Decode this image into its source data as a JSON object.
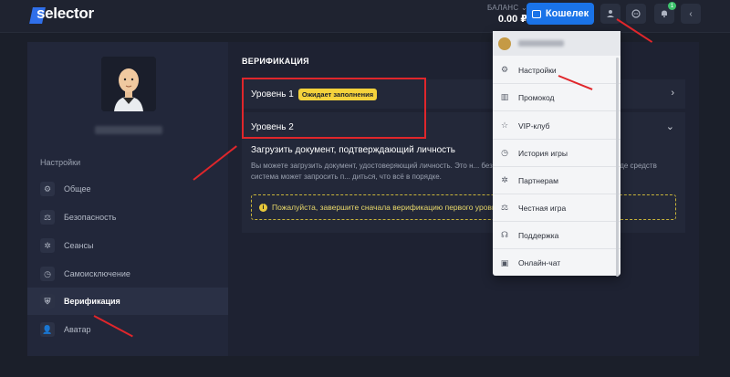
{
  "topbar": {
    "logo": "selector",
    "balance_label": "БАЛАНС ⌄",
    "balance_value": "0.00 ₽",
    "wallet_label": "Кошелек",
    "notif_count": "1"
  },
  "sidebar": {
    "title": "Настройки",
    "items": [
      {
        "label": "Общее",
        "icon": "gear-icon"
      },
      {
        "label": "Безопасность",
        "icon": "scales-icon"
      },
      {
        "label": "Сеансы",
        "icon": "asterisk-icon"
      },
      {
        "label": "Самоисключение",
        "icon": "clock-icon"
      },
      {
        "label": "Верификация",
        "icon": "shield-icon"
      },
      {
        "label": "Аватар",
        "icon": "user-icon"
      }
    ]
  },
  "main": {
    "title": "ВЕРИФИКАЦИЯ",
    "level1_label": "Уровень 1",
    "level1_status": "Ожидает заполнения",
    "level2_label": "Уровень 2",
    "upload_title": "Загрузить документ, подтверждающий личность",
    "upload_text": "Вы можете загрузить документ, удостоверяющий личность. Это н... безопасность аккаунта. Иногда при выводе средств система может запросить п... диться, что всё в порядке.",
    "warning_text": "Пожалуйста, завершите сначала верификацию первого уровня"
  },
  "dropdown": {
    "items": [
      {
        "label": "Настройки",
        "icon": "gear-icon"
      },
      {
        "label": "Промокод",
        "icon": "ticket-icon"
      },
      {
        "label": "VIP-клуб",
        "icon": "star-icon"
      },
      {
        "label": "История игры",
        "icon": "clock-icon"
      },
      {
        "label": "Партнерам",
        "icon": "asterisk-icon"
      },
      {
        "label": "Честная игра",
        "icon": "scales-icon"
      },
      {
        "label": "Поддержка",
        "icon": "headset-icon"
      },
      {
        "label": "Онлайн-чат",
        "icon": "chat-icon"
      }
    ]
  },
  "colors": {
    "accent": "#1a73e8",
    "annotation": "#e0262b",
    "status_pill": "#f4d23c"
  }
}
